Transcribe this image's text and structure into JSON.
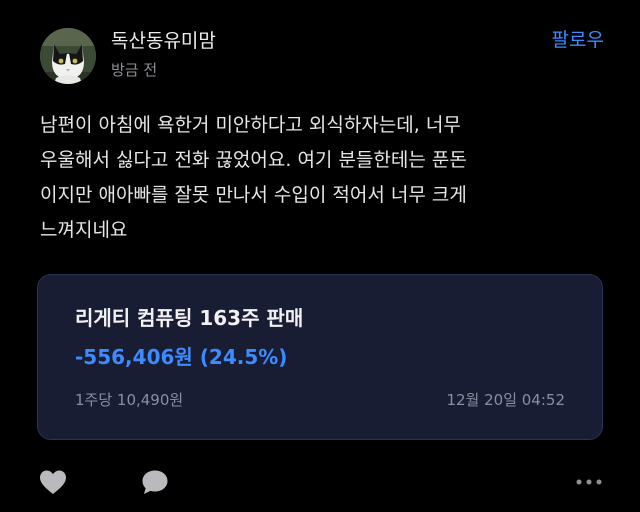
{
  "author": {
    "name": "독산동유미맘",
    "time": "방금 전"
  },
  "follow_label": "팔로우",
  "post": {
    "text": "남편이 아침에 욕한거 미안하다고 외식하자는데, 너무\n우울해서 싫다고 전화 끊었어요. 여기 분들한테는 푼돈\n이지만 애아빠를 잘못 만나서 수입이 적어서 너무 크게\n느껴지네요"
  },
  "trade": {
    "title": "리게티 컴퓨팅 163주 판매",
    "profit_loss": "-556,406원 (24.5%)",
    "per_share": "1주당 10,490원",
    "date": "12월 20일 04:52"
  },
  "colors": {
    "accent": "#3d8bff",
    "loss": "#3d8bff",
    "card_bg": "#181d33",
    "background": "#000000"
  },
  "icons": [
    "heart-icon",
    "comment-icon",
    "more-icon"
  ]
}
